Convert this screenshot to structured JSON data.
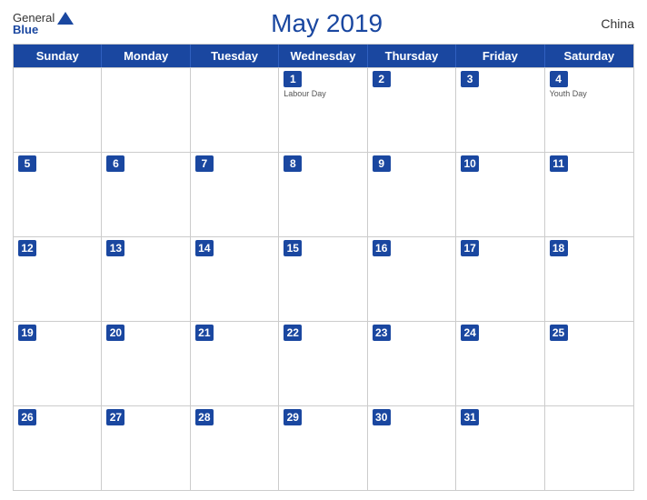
{
  "logo": {
    "general": "General",
    "blue": "Blue"
  },
  "header": {
    "title": "May 2019",
    "country": "China"
  },
  "weekdays": [
    "Sunday",
    "Monday",
    "Tuesday",
    "Wednesday",
    "Thursday",
    "Friday",
    "Saturday"
  ],
  "weeks": [
    [
      {
        "day": "",
        "holiday": ""
      },
      {
        "day": "",
        "holiday": ""
      },
      {
        "day": "",
        "holiday": ""
      },
      {
        "day": "1",
        "holiday": "Labour Day"
      },
      {
        "day": "2",
        "holiday": ""
      },
      {
        "day": "3",
        "holiday": ""
      },
      {
        "day": "4",
        "holiday": "Youth Day"
      }
    ],
    [
      {
        "day": "5",
        "holiday": ""
      },
      {
        "day": "6",
        "holiday": ""
      },
      {
        "day": "7",
        "holiday": ""
      },
      {
        "day": "8",
        "holiday": ""
      },
      {
        "day": "9",
        "holiday": ""
      },
      {
        "day": "10",
        "holiday": ""
      },
      {
        "day": "11",
        "holiday": ""
      }
    ],
    [
      {
        "day": "12",
        "holiday": ""
      },
      {
        "day": "13",
        "holiday": ""
      },
      {
        "day": "14",
        "holiday": ""
      },
      {
        "day": "15",
        "holiday": ""
      },
      {
        "day": "16",
        "holiday": ""
      },
      {
        "day": "17",
        "holiday": ""
      },
      {
        "day": "18",
        "holiday": ""
      }
    ],
    [
      {
        "day": "19",
        "holiday": ""
      },
      {
        "day": "20",
        "holiday": ""
      },
      {
        "day": "21",
        "holiday": ""
      },
      {
        "day": "22",
        "holiday": ""
      },
      {
        "day": "23",
        "holiday": ""
      },
      {
        "day": "24",
        "holiday": ""
      },
      {
        "day": "25",
        "holiday": ""
      }
    ],
    [
      {
        "day": "26",
        "holiday": ""
      },
      {
        "day": "27",
        "holiday": ""
      },
      {
        "day": "28",
        "holiday": ""
      },
      {
        "day": "29",
        "holiday": ""
      },
      {
        "day": "30",
        "holiday": ""
      },
      {
        "day": "31",
        "holiday": ""
      },
      {
        "day": "",
        "holiday": ""
      }
    ]
  ]
}
